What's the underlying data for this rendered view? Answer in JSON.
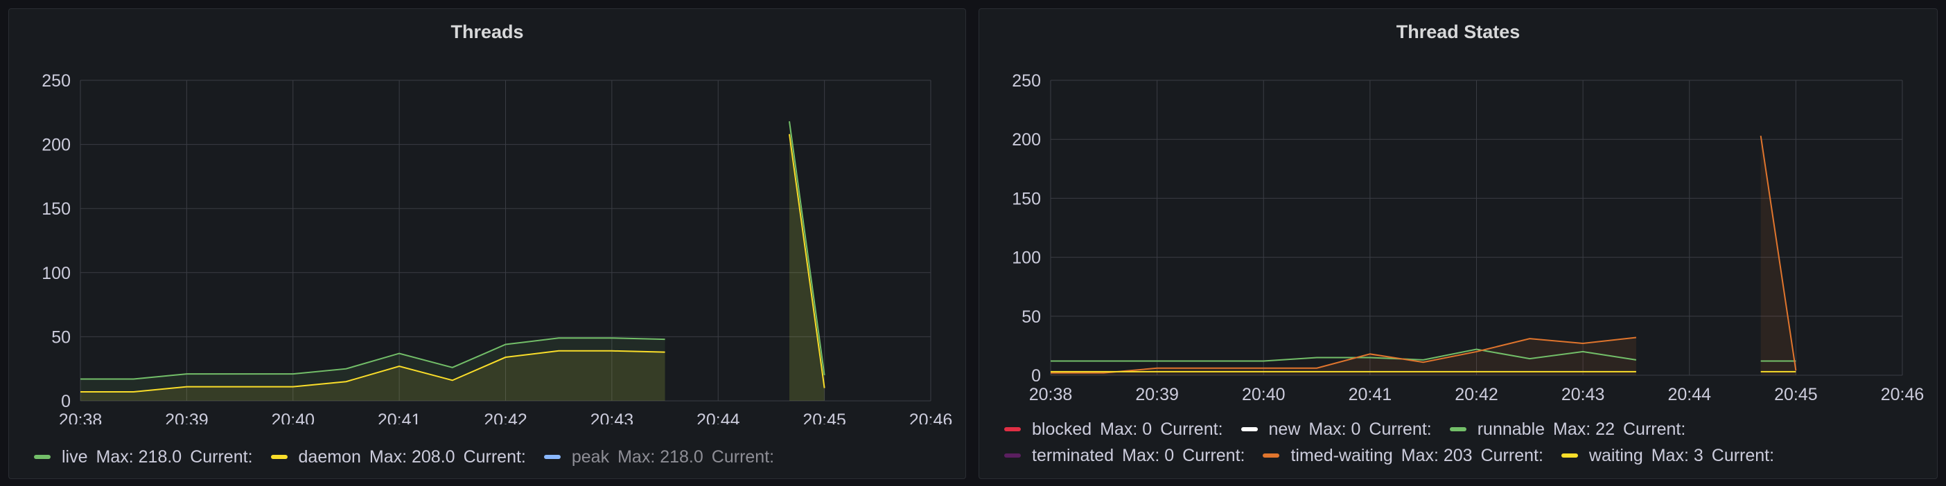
{
  "panels": [
    {
      "title": "Threads",
      "legend": [
        {
          "name": "live",
          "color": "#73bf69",
          "max": "Max: 218.0",
          "current": "Current:",
          "dim": false
        },
        {
          "name": "daemon",
          "color": "#fade2a",
          "max": "Max: 208.0",
          "current": "Current:",
          "dim": false
        },
        {
          "name": "peak",
          "color": "#8ab8ff",
          "max": "Max: 218.0",
          "current": "Current:",
          "dim": true
        }
      ]
    },
    {
      "title": "Thread States",
      "legend_row1": [
        {
          "name": "blocked",
          "color": "#e02f44",
          "max": "Max: 0",
          "current": "Current:"
        },
        {
          "name": "new",
          "color": "#ffffff",
          "max": "Max: 0",
          "current": "Current:"
        },
        {
          "name": "runnable",
          "color": "#73bf69",
          "max": "Max: 22",
          "current": "Current:"
        }
      ],
      "legend_row2": [
        {
          "name": "terminated",
          "color": "#5a1f5f",
          "max": "Max: 0",
          "current": "Current:"
        },
        {
          "name": "timed-waiting",
          "color": "#e0752d",
          "max": "Max: 203",
          "current": "Current:"
        },
        {
          "name": "waiting",
          "color": "#fade2a",
          "max": "Max: 3",
          "current": "Current:"
        }
      ]
    }
  ],
  "chart_data": [
    {
      "type": "line",
      "title": "Threads",
      "ylim": [
        0,
        250
      ],
      "yticks": [
        0,
        50,
        100,
        150,
        200,
        250
      ],
      "xticks": [
        "20:38",
        "20:39",
        "20:40",
        "20:41",
        "20:42",
        "20:43",
        "20:44",
        "20:45",
        "20:46"
      ],
      "grid": true,
      "legend_position": "bottom",
      "series": [
        {
          "name": "live",
          "color": "#73bf69",
          "fill": true,
          "segments": [
            [
              [
                0,
                17
              ],
              [
                0.5,
                17
              ],
              [
                1,
                21
              ],
              [
                1.5,
                21
              ],
              [
                2,
                21
              ],
              [
                2.5,
                25
              ],
              [
                3,
                37
              ],
              [
                3.5,
                26
              ],
              [
                4,
                44
              ],
              [
                4.5,
                49
              ],
              [
                5,
                49
              ],
              [
                5.5,
                48
              ]
            ],
            [
              [
                6.67,
                218
              ],
              [
                7,
                20
              ]
            ]
          ]
        },
        {
          "name": "daemon",
          "color": "#fade2a",
          "fill": true,
          "segments": [
            [
              [
                0,
                7
              ],
              [
                0.5,
                7
              ],
              [
                1,
                11
              ],
              [
                1.5,
                11
              ],
              [
                2,
                11
              ],
              [
                2.5,
                15
              ],
              [
                3,
                27
              ],
              [
                3.5,
                16
              ],
              [
                4,
                34
              ],
              [
                4.5,
                39
              ],
              [
                5,
                39
              ],
              [
                5.5,
                38
              ]
            ],
            [
              [
                6.67,
                208
              ],
              [
                7,
                10
              ]
            ]
          ]
        }
      ]
    },
    {
      "type": "line",
      "title": "Thread States",
      "ylim": [
        0,
        250
      ],
      "yticks": [
        0,
        50,
        100,
        150,
        200,
        250
      ],
      "xticks": [
        "20:38",
        "20:39",
        "20:40",
        "20:41",
        "20:42",
        "20:43",
        "20:44",
        "20:45",
        "20:46"
      ],
      "grid": true,
      "legend_position": "bottom",
      "series": [
        {
          "name": "runnable",
          "color": "#73bf69",
          "fill": false,
          "segments": [
            [
              [
                0,
                12
              ],
              [
                0.5,
                12
              ],
              [
                1,
                12
              ],
              [
                1.5,
                12
              ],
              [
                2,
                12
              ],
              [
                2.5,
                15
              ],
              [
                3,
                15
              ],
              [
                3.5,
                13
              ],
              [
                4,
                22
              ],
              [
                4.5,
                14
              ],
              [
                5,
                20
              ],
              [
                5.5,
                13
              ]
            ],
            [
              [
                6.67,
                12
              ],
              [
                7,
                12
              ]
            ]
          ]
        },
        {
          "name": "timed-waiting",
          "color": "#e0752d",
          "fill": true,
          "segments": [
            [
              [
                0,
                2
              ],
              [
                0.5,
                2
              ],
              [
                1,
                6
              ],
              [
                1.5,
                6
              ],
              [
                2,
                6
              ],
              [
                2.5,
                6
              ],
              [
                3,
                18
              ],
              [
                3.5,
                11
              ],
              [
                4,
                20
              ],
              [
                4.5,
                31
              ],
              [
                5,
                27
              ],
              [
                5.5,
                32
              ]
            ],
            [
              [
                6.67,
                203
              ],
              [
                7,
                4
              ]
            ]
          ]
        },
        {
          "name": "waiting",
          "color": "#fade2a",
          "fill": false,
          "segments": [
            [
              [
                0,
                3
              ],
              [
                0.5,
                3
              ],
              [
                1,
                3
              ],
              [
                1.5,
                3
              ],
              [
                2,
                3
              ],
              [
                2.5,
                3
              ],
              [
                3,
                3
              ],
              [
                3.5,
                3
              ],
              [
                4,
                3
              ],
              [
                4.5,
                3
              ],
              [
                5,
                3
              ],
              [
                5.5,
                3
              ]
            ],
            [
              [
                6.67,
                3
              ],
              [
                7,
                3
              ]
            ]
          ]
        }
      ]
    }
  ]
}
